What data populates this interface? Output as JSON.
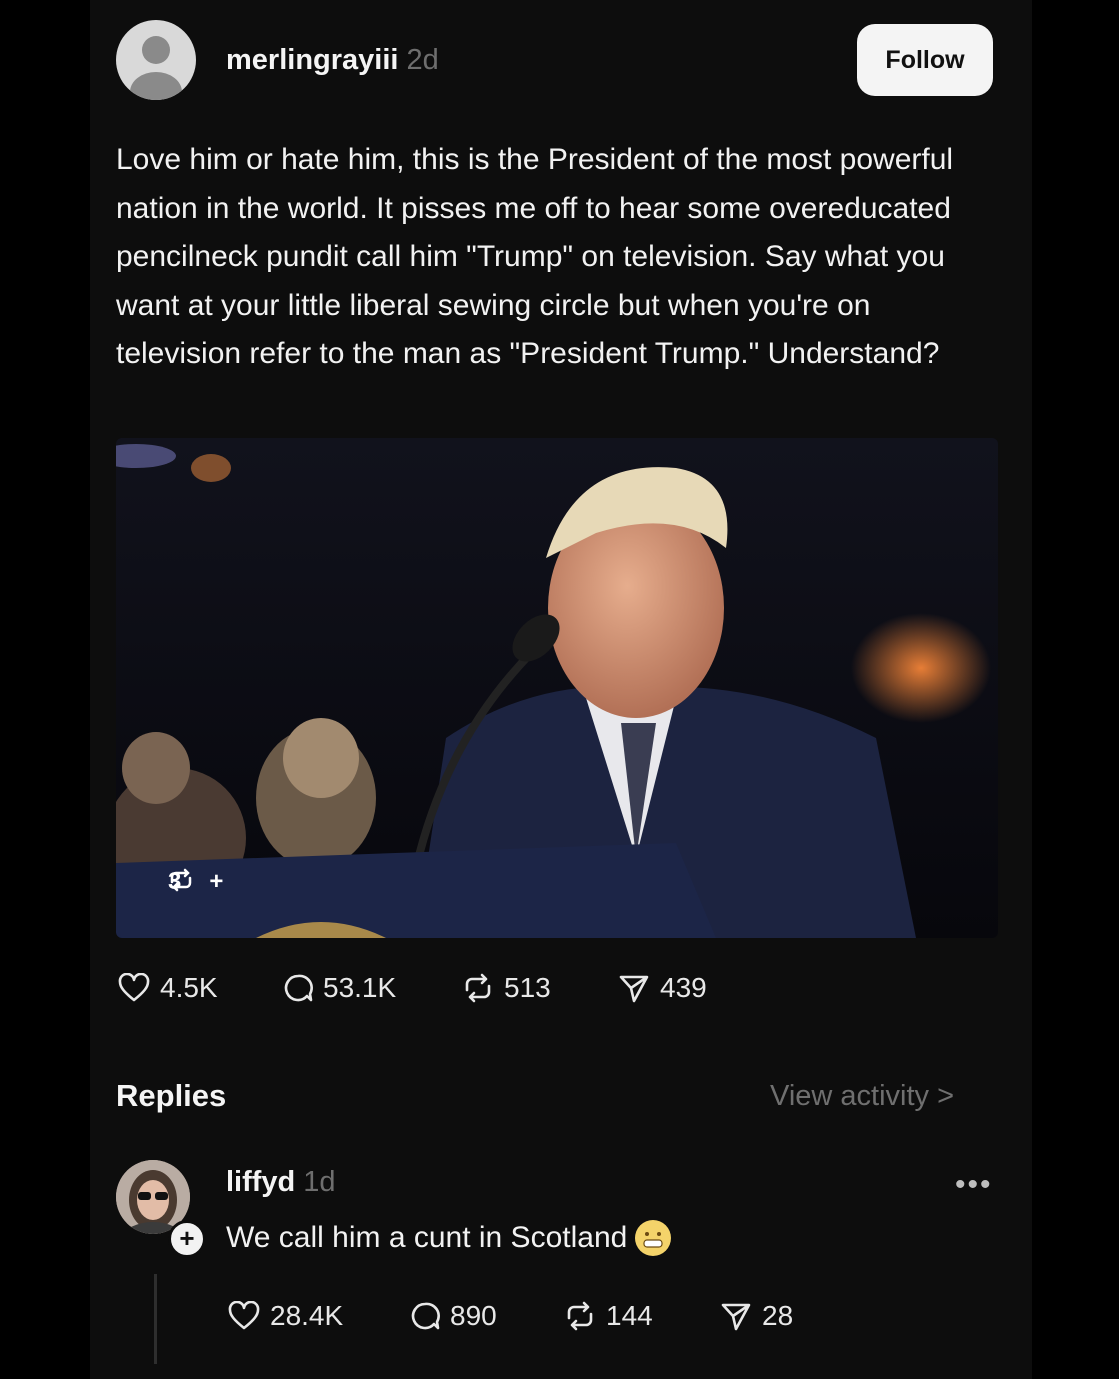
{
  "post": {
    "username": "merlingrayiii",
    "time": "2d",
    "follow_label": "Follow",
    "text": "Love him or hate him, this is the President of the most powerful nation in the world. It pisses me off to hear some overeducated pencilneck pundit call him \"Trump\" on television.  Say what you want at your little liberal sewing circle but when you're on television refer to the man as \"President Trump.\" Understand?",
    "image_overlay": {
      "repost_count": "3",
      "add_label": "+"
    },
    "stats": {
      "likes": "4.5K",
      "comments": "53.1K",
      "reposts": "513",
      "shares": "439"
    }
  },
  "replies": {
    "title": "Replies",
    "view_activity": "View activity >",
    "items": [
      {
        "username": "liffyd",
        "time": "1d",
        "text": "We call him a cunt in Scotland",
        "stats": {
          "likes": "28.4K",
          "comments": "890",
          "reposts": "144",
          "shares": "28"
        }
      }
    ]
  },
  "icons": {
    "like": "heart-icon",
    "comment": "speech-bubble-icon",
    "repost": "repost-icon",
    "share": "send-icon",
    "more": "ellipsis-icon"
  },
  "colors": {
    "background": "#0d0d0d",
    "text": "#f2f2f2",
    "muted": "#6e6e6e",
    "follow_bg": "#f4f4f4"
  }
}
